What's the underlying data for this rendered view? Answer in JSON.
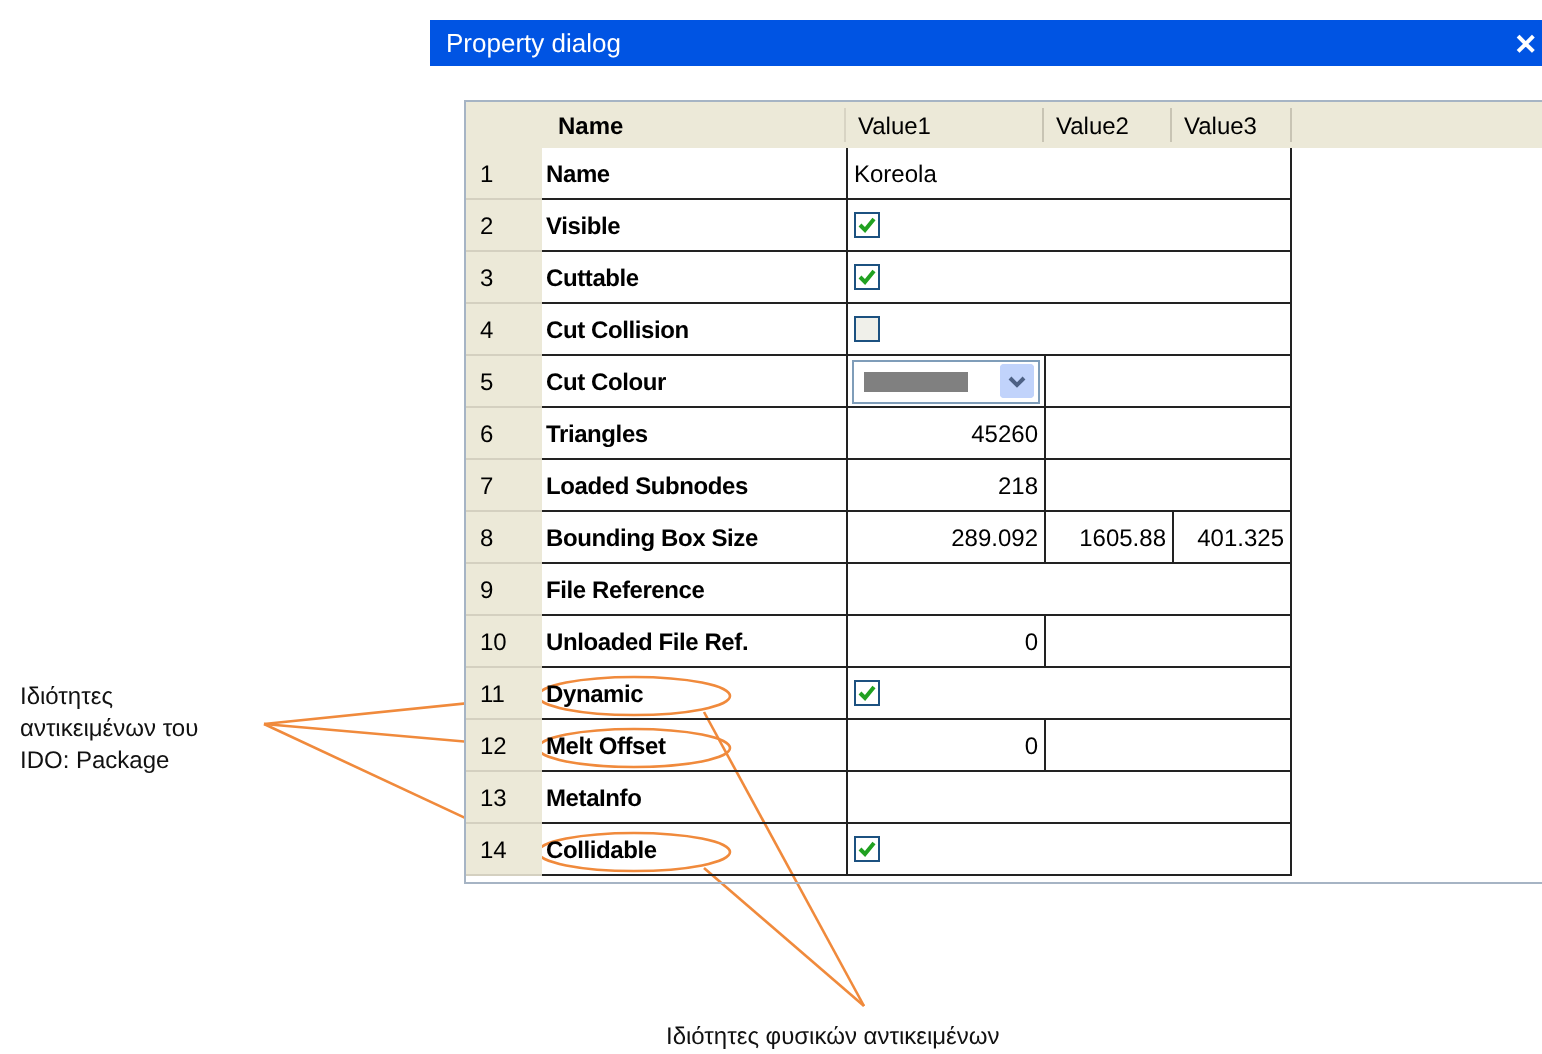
{
  "window": {
    "title": "Property dialog",
    "close_glyph": "✕"
  },
  "table": {
    "columns": [
      {
        "label": "Name"
      },
      {
        "label": "Value1"
      },
      {
        "label": "Value2"
      },
      {
        "label": "Value3"
      }
    ],
    "rows": [
      {
        "number": "1",
        "name": "Name",
        "kind": "text",
        "value": "Koreola",
        "linked": [
          false,
          false
        ]
      },
      {
        "number": "2",
        "name": "Visible",
        "kind": "checkbox",
        "checked": true,
        "linked": [
          false,
          false
        ]
      },
      {
        "number": "3",
        "name": "Cuttable",
        "kind": "checkbox",
        "checked": true,
        "linked": [
          false,
          false
        ]
      },
      {
        "number": "4",
        "name": "Cut Collision",
        "kind": "checkbox",
        "checked": false,
        "linked": [
          false,
          false
        ]
      },
      {
        "number": "5",
        "name": "Cut Colour",
        "kind": "color",
        "color": "#808080",
        "linked": [
          false,
          false
        ]
      },
      {
        "number": "6",
        "name": "Triangles",
        "kind": "number",
        "value": "45260",
        "linked": [
          false,
          false
        ]
      },
      {
        "number": "7",
        "name": "Loaded Subnodes",
        "kind": "number",
        "value": "218",
        "linked": [
          false,
          false
        ]
      },
      {
        "number": "8",
        "name": "Bounding Box Size",
        "kind": "triple",
        "values": [
          "289.092",
          "1605.88",
          "401.325"
        ],
        "linked": [
          false,
          false
        ]
      },
      {
        "number": "9",
        "name": "File Reference",
        "kind": "empty",
        "linked": [
          false,
          false
        ]
      },
      {
        "number": "10",
        "name": "Unloaded File Ref.",
        "kind": "number",
        "value": "0",
        "linked": [
          false,
          false
        ]
      },
      {
        "number": "11",
        "name": "Dynamic",
        "kind": "checkbox",
        "checked": true,
        "linked": [
          true,
          true
        ]
      },
      {
        "number": "12",
        "name": "Melt Offset",
        "kind": "number",
        "value": "0",
        "linked": [
          true,
          false
        ]
      },
      {
        "number": "13",
        "name": "MetaInfo",
        "kind": "empty",
        "linked": [
          false,
          false
        ]
      },
      {
        "number": "14",
        "name": "Collidable",
        "kind": "checkbox",
        "checked": true,
        "linked": [
          true,
          true
        ]
      }
    ]
  },
  "callouts": [
    {
      "text": "Ιδιότητες αντικειμένων του IDO: Package"
    },
    {
      "text": "Ιδιότητες φυσικών αντικειμένων"
    }
  ]
}
